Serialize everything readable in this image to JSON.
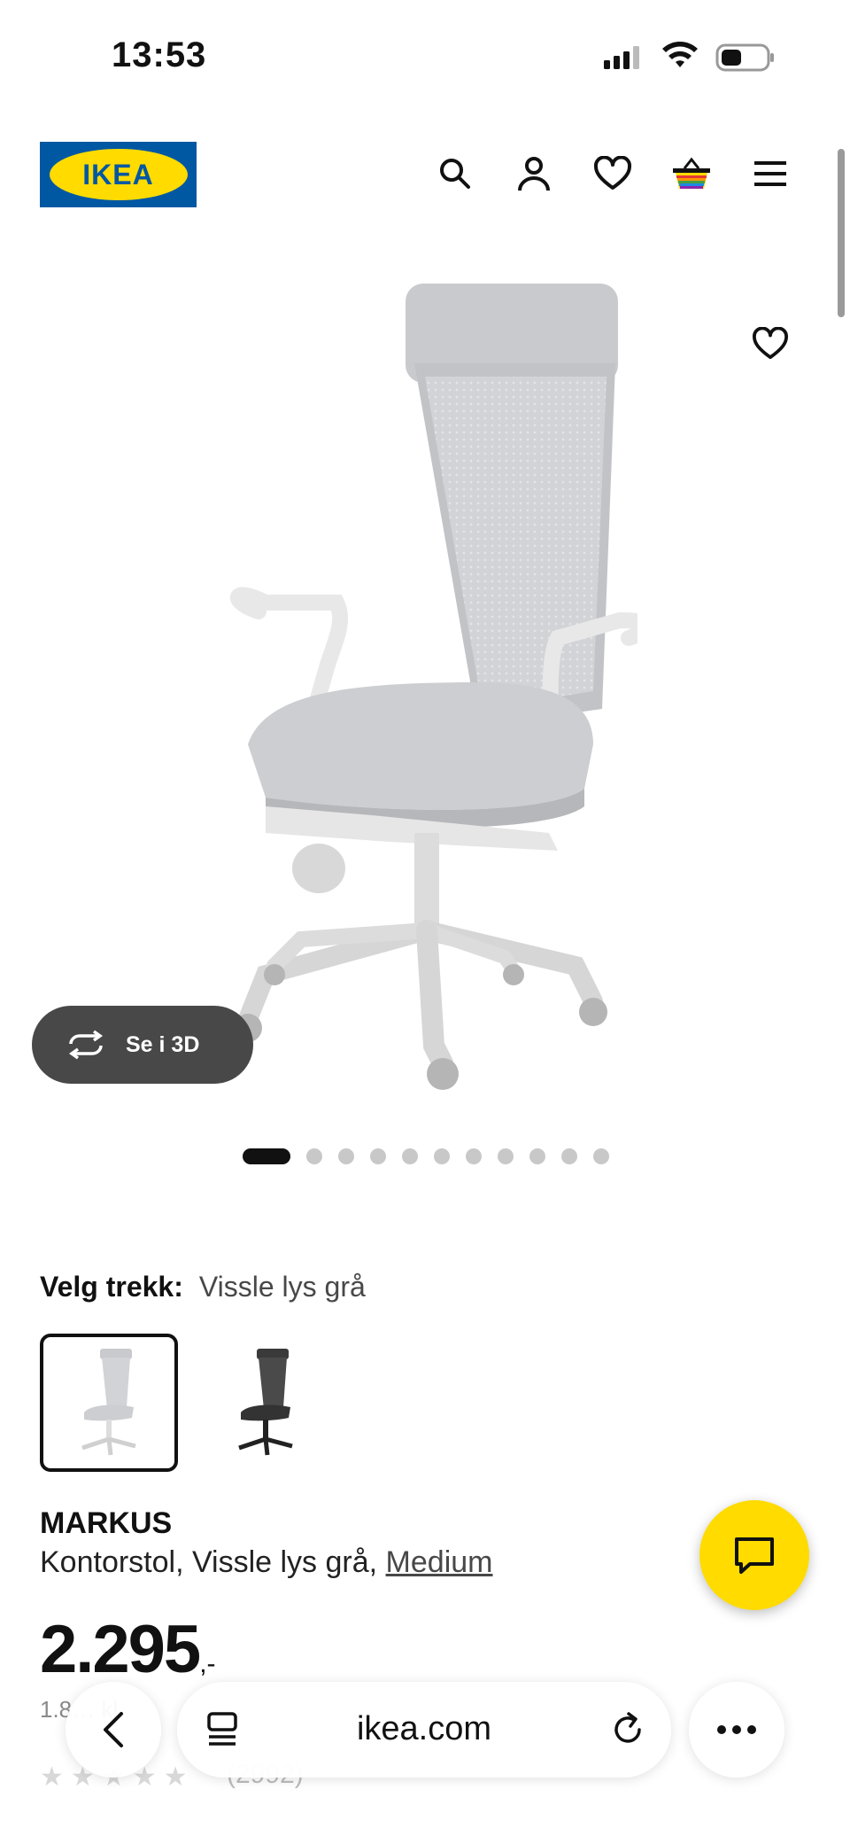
{
  "status_bar": {
    "time": "13:53"
  },
  "header": {
    "logo_text": "IKEA"
  },
  "gallery": {
    "see_3d_label": "Se i 3D",
    "dot_count": 11,
    "active_dot": 0
  },
  "variant": {
    "label": "Velg trekk:",
    "value": "Vissle lys grå"
  },
  "product": {
    "name": "MARKUS",
    "description": "Kontorstol, Vissle lys grå, ",
    "size_link": "Medium",
    "price_main": "2.295",
    "price_suffix": ",-",
    "price_note": "1.8… kl.",
    "rating_count": "(2992)"
  },
  "browser": {
    "url": "ikea.com"
  },
  "colors": {
    "ikea_blue": "#0058a3",
    "ikea_yellow": "#ffdb00",
    "chat_yellow": "#ffdb00"
  }
}
